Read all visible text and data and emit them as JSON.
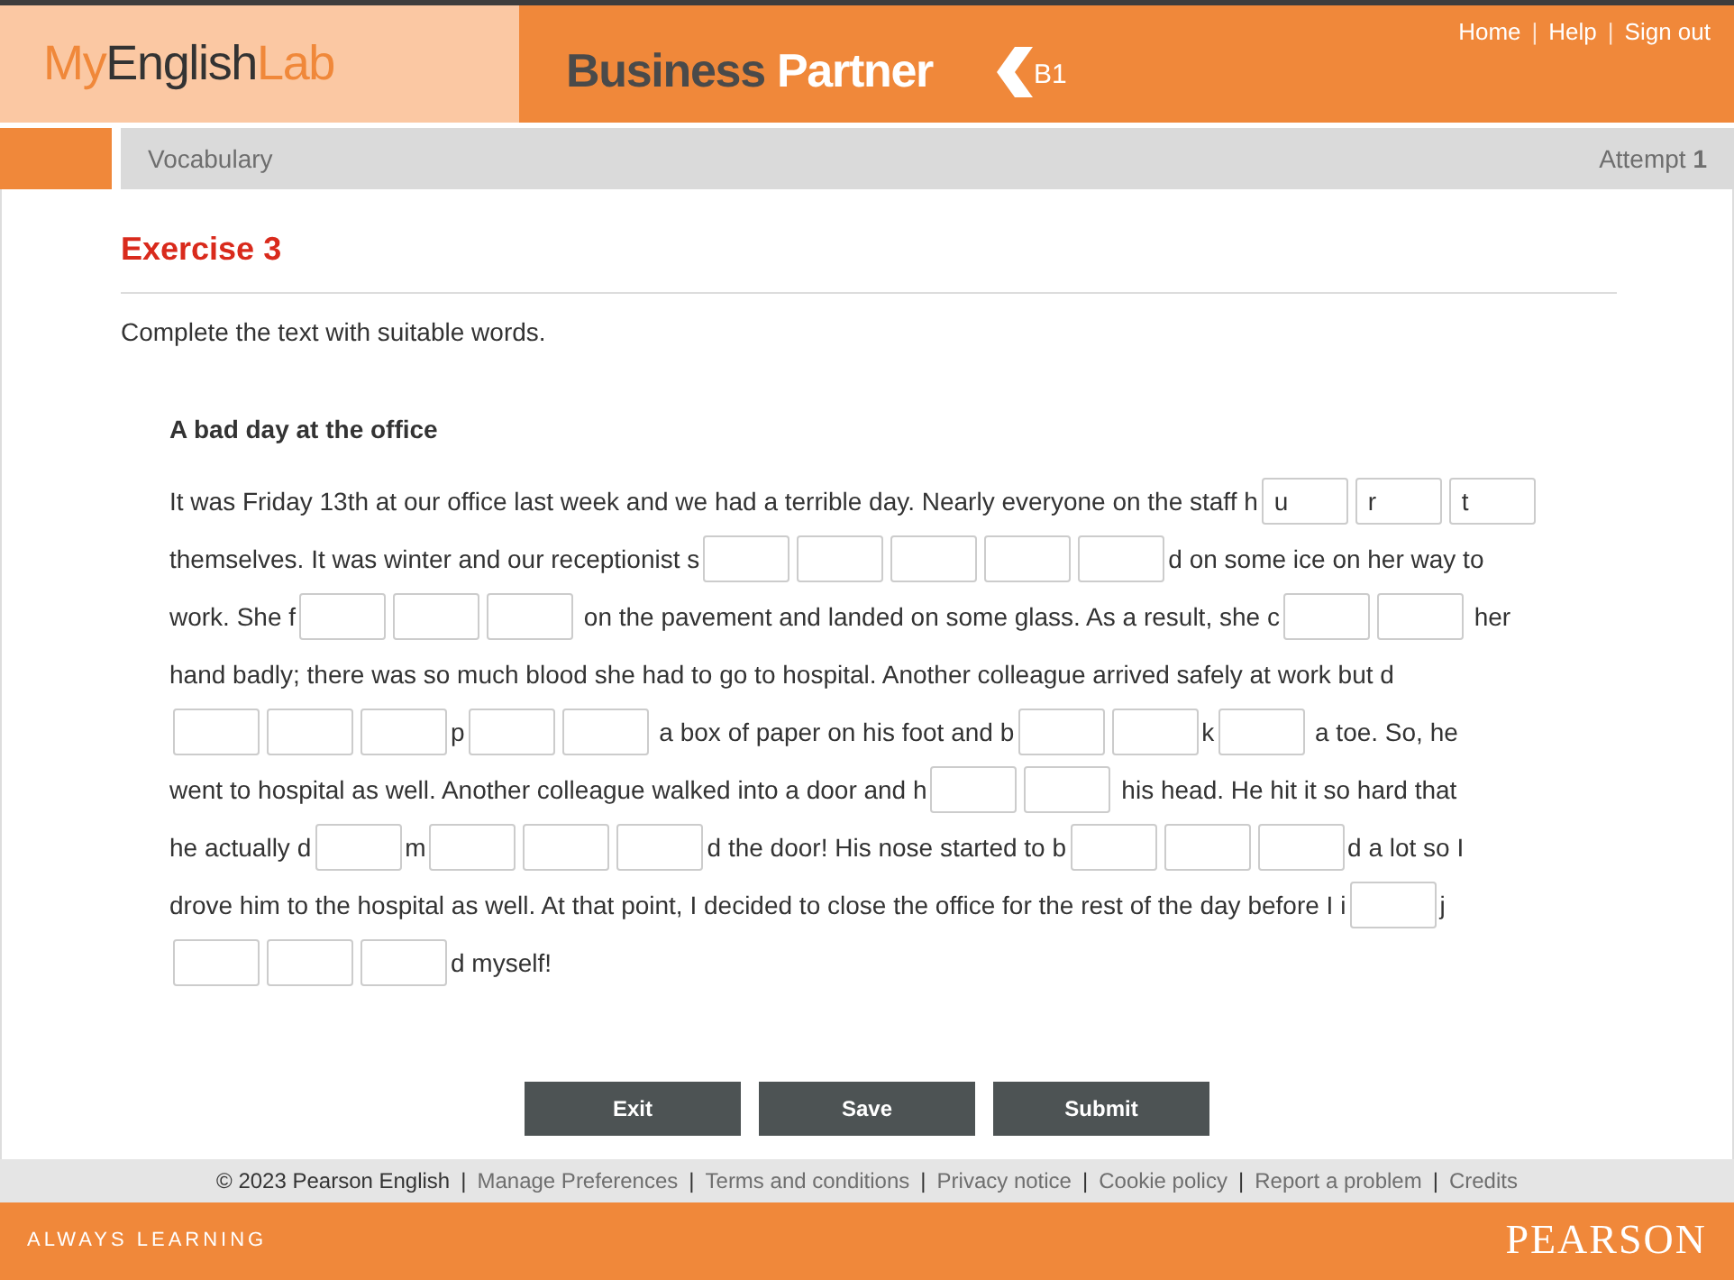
{
  "header": {
    "logo": {
      "my": "My",
      "english": "English",
      "lab": "Lab"
    },
    "product": {
      "word_1": "Business",
      "word_2": "Partner"
    },
    "level": "B1",
    "links": [
      {
        "kind": "link",
        "text": "Home"
      },
      {
        "kind": "separator",
        "text": "|"
      },
      {
        "kind": "link",
        "text": "Help"
      },
      {
        "kind": "separator",
        "text": "|"
      },
      {
        "kind": "link",
        "text": "Sign out"
      }
    ]
  },
  "bar": {
    "section": "Vocabulary",
    "attempt_label": "Attempt",
    "attempt_number": "1"
  },
  "exercise": {
    "title": "Exercise 3",
    "instruction": "Complete the text with suitable words.",
    "passage_title": "A bad day at the office",
    "lines": [
      [
        {
          "kind": "text",
          "text": "It was Friday 13th at our office last week and we had a terrible day. Nearly everyone on the staff h"
        },
        {
          "kind": "blank",
          "value": "u"
        },
        {
          "kind": "blank",
          "value": "r"
        },
        {
          "kind": "blank",
          "value": "t"
        }
      ],
      [
        {
          "kind": "text",
          "text": "themselves. It was winter and our receptionist s"
        },
        {
          "kind": "blank"
        },
        {
          "kind": "blank"
        },
        {
          "kind": "blank"
        },
        {
          "kind": "blank"
        },
        {
          "kind": "blank"
        },
        {
          "kind": "text",
          "text": "d on some ice on her way to"
        }
      ],
      [
        {
          "kind": "text",
          "text": "work. She f"
        },
        {
          "kind": "blank"
        },
        {
          "kind": "blank"
        },
        {
          "kind": "blank"
        },
        {
          "kind": "text",
          "text": " on the pavement and landed on some glass. As a result, she c"
        },
        {
          "kind": "blank"
        },
        {
          "kind": "blank"
        },
        {
          "kind": "text",
          "text": " her"
        }
      ],
      [
        {
          "kind": "text",
          "text": "hand badly; there was so much blood she had to go to hospital. Another colleague arrived safely at work but d"
        }
      ],
      [
        {
          "kind": "blank"
        },
        {
          "kind": "blank"
        },
        {
          "kind": "blank"
        },
        {
          "kind": "text",
          "text": "p"
        },
        {
          "kind": "blank"
        },
        {
          "kind": "blank"
        },
        {
          "kind": "text",
          "text": " a box of paper on his foot and b"
        },
        {
          "kind": "blank"
        },
        {
          "kind": "blank"
        },
        {
          "kind": "text",
          "text": "k"
        },
        {
          "kind": "blank"
        },
        {
          "kind": "text",
          "text": " a toe. So, he"
        }
      ],
      [
        {
          "kind": "text",
          "text": "went to hospital as well. Another colleague walked into a door and h"
        },
        {
          "kind": "blank"
        },
        {
          "kind": "blank"
        },
        {
          "kind": "text",
          "text": " his head. He hit it so hard that"
        }
      ],
      [
        {
          "kind": "text",
          "text": "he actually d"
        },
        {
          "kind": "blank"
        },
        {
          "kind": "text",
          "text": "m"
        },
        {
          "kind": "blank"
        },
        {
          "kind": "blank"
        },
        {
          "kind": "blank"
        },
        {
          "kind": "text",
          "text": "d the door! His nose started to b"
        },
        {
          "kind": "blank"
        },
        {
          "kind": "blank"
        },
        {
          "kind": "blank"
        },
        {
          "kind": "text",
          "text": "d a lot so I"
        }
      ],
      [
        {
          "kind": "text",
          "text": "drove him to the hospital as well. At that point, I decided to close the office for the rest of the day before I i"
        },
        {
          "kind": "blank"
        },
        {
          "kind": "text",
          "text": "j"
        }
      ],
      [
        {
          "kind": "blank"
        },
        {
          "kind": "blank"
        },
        {
          "kind": "blank"
        },
        {
          "kind": "text",
          "text": "d myself!"
        }
      ]
    ]
  },
  "buttons": [
    "Exit",
    "Save",
    "Submit"
  ],
  "footer": {
    "copyright": "© 2023 Pearson English",
    "links": [
      {
        "kind": "separator",
        "text": "|"
      },
      {
        "kind": "link",
        "text": "Manage Preferences"
      },
      {
        "kind": "separator",
        "text": "|"
      },
      {
        "kind": "link",
        "text": "Terms and conditions"
      },
      {
        "kind": "separator",
        "text": "|"
      },
      {
        "kind": "link",
        "text": "Privacy notice"
      },
      {
        "kind": "separator",
        "text": "|"
      },
      {
        "kind": "link",
        "text": "Cookie policy"
      },
      {
        "kind": "separator",
        "text": "|"
      },
      {
        "kind": "link",
        "text": "Report a problem"
      },
      {
        "kind": "separator",
        "text": "|"
      },
      {
        "kind": "link",
        "text": "Credits"
      }
    ],
    "tagline": "ALWAYS LEARNING",
    "brand": "PEARSON"
  }
}
